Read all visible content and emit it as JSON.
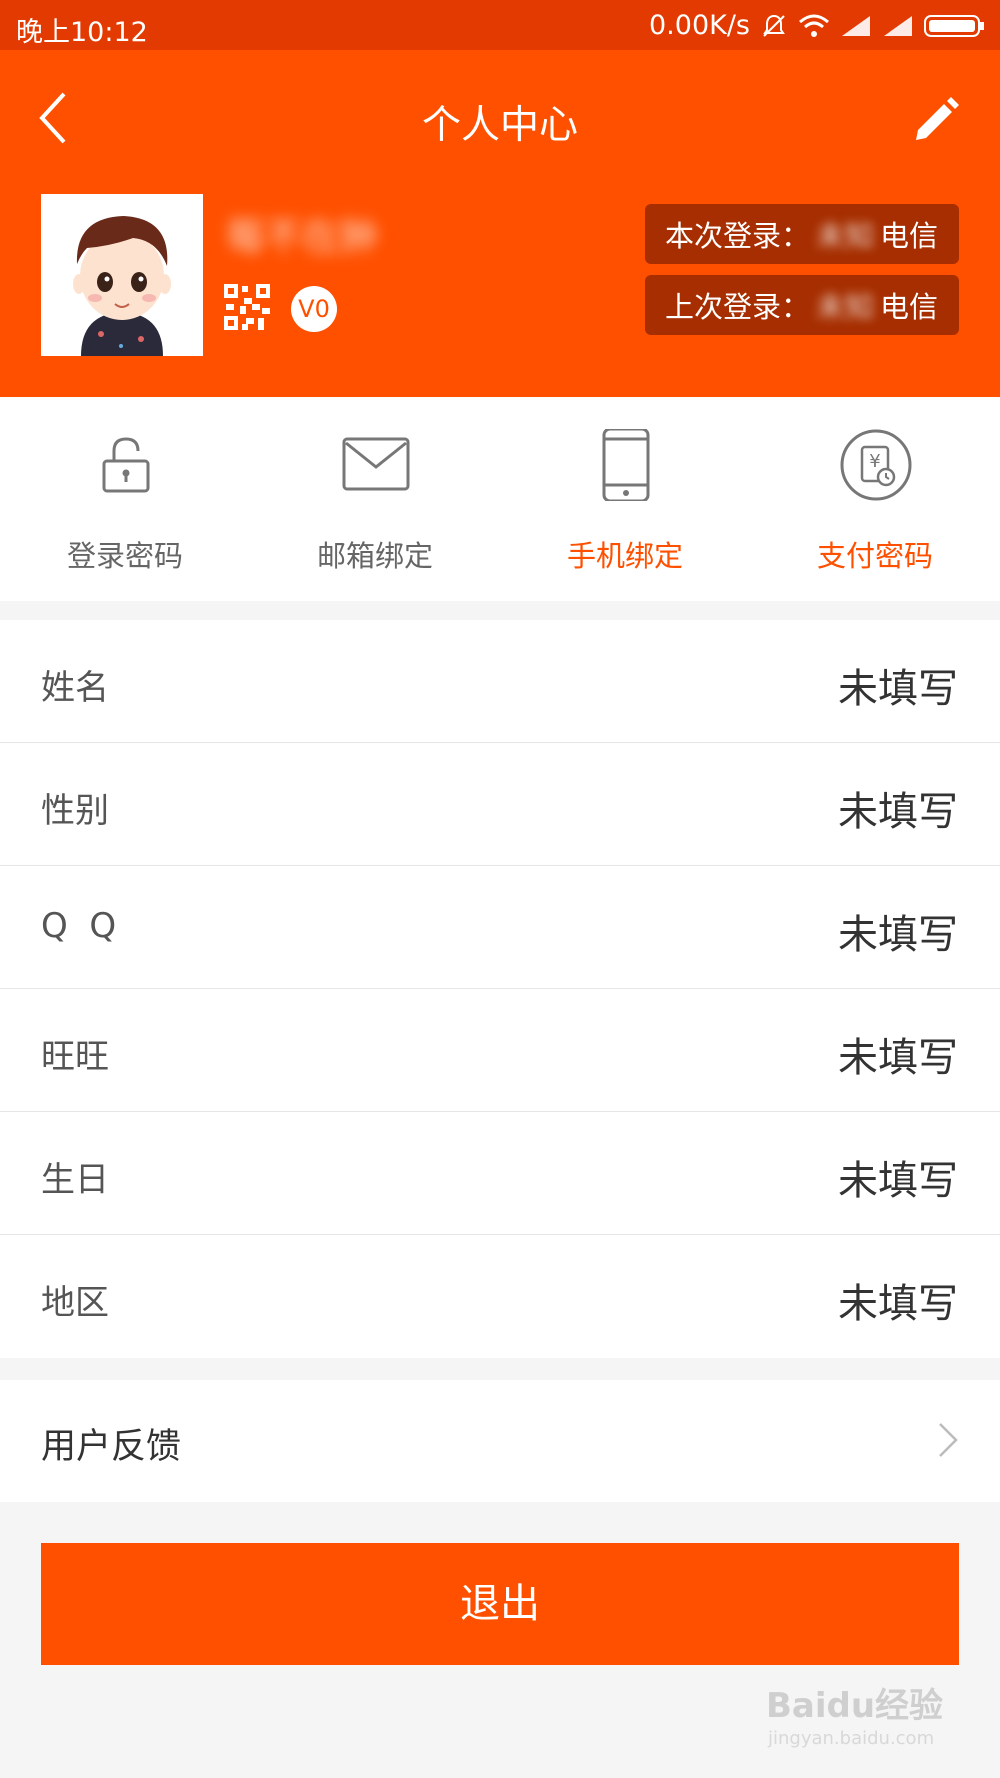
{
  "status_bar": {
    "time": "晚上10:12",
    "network_speed": "0.00K/s"
  },
  "header": {
    "title": "个人中心",
    "username": "莓不在肿",
    "vip_level": "V0",
    "this_login_label": "本次登录：",
    "this_login_location": "未知",
    "this_login_isp": "电信",
    "last_login_label": "上次登录：",
    "last_login_location": "未知",
    "last_login_isp": "电信"
  },
  "quick_actions": [
    {
      "label": "登录密码",
      "icon": "lock-icon"
    },
    {
      "label": "邮箱绑定",
      "icon": "mail-icon"
    },
    {
      "label": "手机绑定",
      "icon": "phone-icon"
    },
    {
      "label": "支付密码",
      "icon": "payment-password-icon"
    }
  ],
  "profile_fields": [
    {
      "label": "姓名",
      "value": "未填写"
    },
    {
      "label": "性别",
      "value": "未填写"
    },
    {
      "label": "Q  Q",
      "value": "未填写"
    },
    {
      "label": "旺旺",
      "value": "未填写"
    },
    {
      "label": "生日",
      "value": "未填写"
    },
    {
      "label": "地区",
      "value": "未填写"
    }
  ],
  "feedback": {
    "label": "用户反馈"
  },
  "logout": {
    "label": "退出"
  },
  "watermark": {
    "brand": "Baidu经验",
    "url": "jingyan.baidu.com"
  },
  "colors": {
    "accent": "#ff5000",
    "status_bar": "#e23a00",
    "badge_bg": "#a62e00"
  }
}
